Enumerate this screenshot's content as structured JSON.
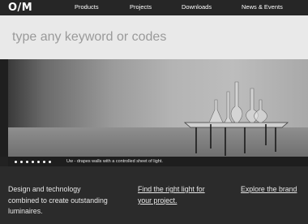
{
  "header": {
    "logo": "O/M",
    "nav": [
      "Products",
      "Projects",
      "Downloads",
      "News & Events"
    ]
  },
  "search": {
    "placeholder": "type any keyword or codes"
  },
  "hero": {
    "caption": "Uw - drapes walls with a controlled sheet of light.",
    "slide_count": 7,
    "active_slide": 1
  },
  "footer": {
    "tagline": "Design and technology combined to create outstanding luminaires.",
    "link_find": "Find the right light for your project.",
    "link_brand": "Explore the brand"
  },
  "colors": {
    "nav_bg": "#262626",
    "search_bg": "#e9e9e9",
    "bottom_bg": "#2b2b2b"
  }
}
